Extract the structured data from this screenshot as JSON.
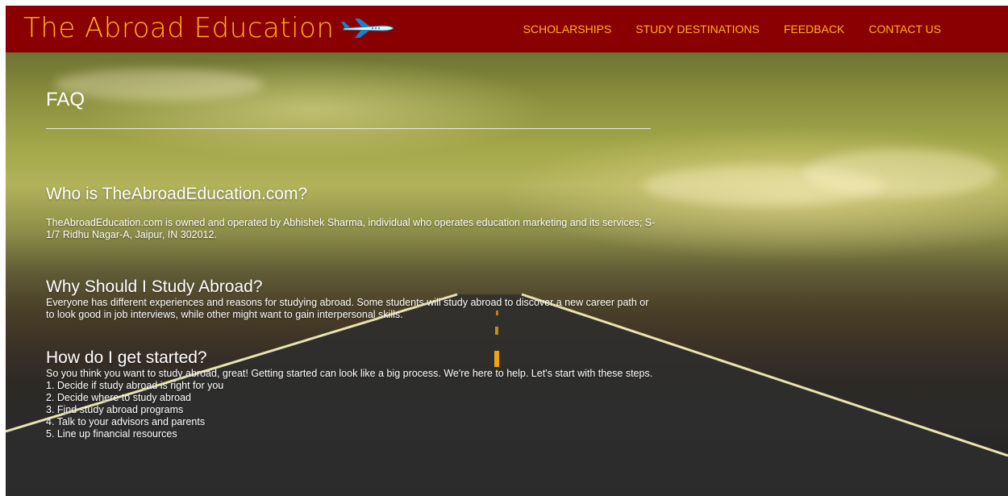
{
  "header": {
    "logo_text": "The Abroad Education",
    "logo_icon": "airplane-icon",
    "nav": [
      {
        "label": "SCHOLARSHIPS"
      },
      {
        "label": "STUDY DESTINATIONS"
      },
      {
        "label": "FEEDBACK"
      },
      {
        "label": "CONTACT US"
      }
    ]
  },
  "colors": {
    "header_bg": "#8a0000",
    "brand_accent": "#ffb11d"
  },
  "faq": {
    "title": "FAQ",
    "items": [
      {
        "question": "Who is TheAbroadEducation.com?",
        "answer": "TheAbroadEducation.com is owned and operated by Abhishek Sharma, individual who operates education marketing and its services; S-1/7 Ridhu Nagar-A, Jaipur, IN 302012."
      },
      {
        "question": "Why Should I Study Abroad?",
        "answer": "Everyone has different experiences and reasons for studying abroad. Some students will study abroad to discover a new career path or to look good in job interviews, while other might want to gain interpersonal skills."
      },
      {
        "question": "How do I get started?",
        "answer": "So you think you want to study abroad, great! Getting started can look like a big process. We're here to help. Let's start with these steps.",
        "steps": [
          "1. Decide if study abroad is right for you",
          "2. Decide where to study abroad",
          "3. Find study abroad programs",
          "4. Talk to your advisors and parents",
          "5. Line up financial resources"
        ]
      }
    ]
  }
}
